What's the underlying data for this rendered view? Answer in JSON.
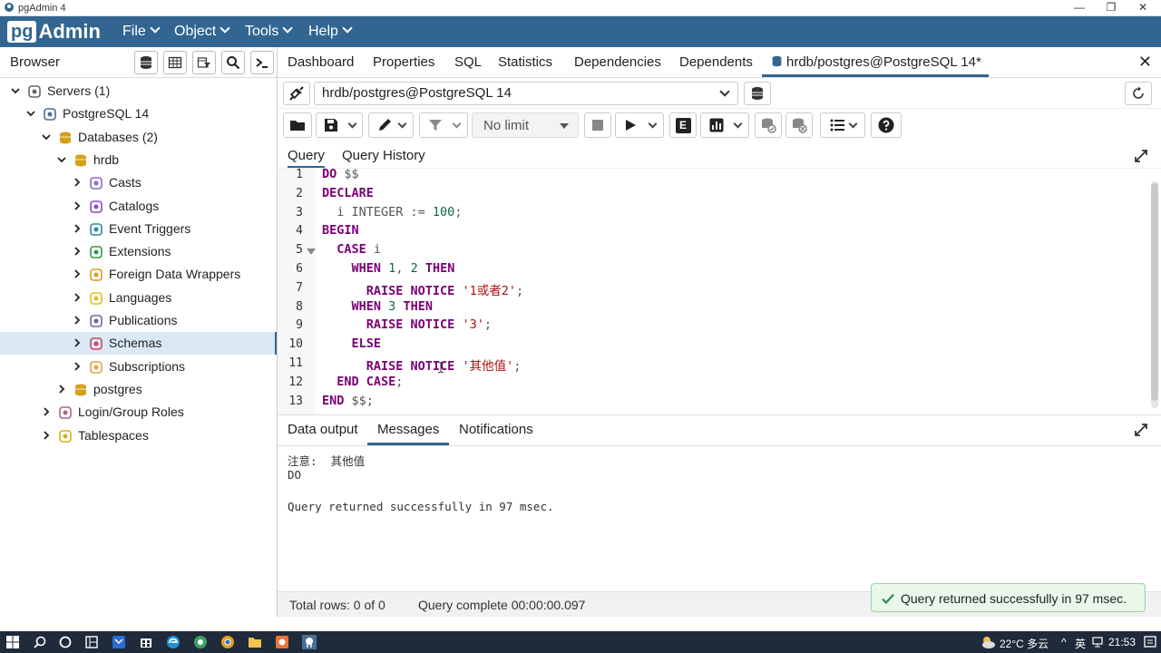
{
  "window": {
    "title": "pgAdmin 4",
    "minimize": "—",
    "maximize": "❐",
    "close": "✕"
  },
  "menubar": {
    "logo_pg": "pg",
    "logo_admin": "Admin",
    "items": [
      "File",
      "Object",
      "Tools",
      "Help"
    ]
  },
  "browser": {
    "label": "Browser",
    "tree": [
      {
        "label": "Servers (1)",
        "icon": "servers-icon"
      },
      {
        "label": "PostgreSQL 14",
        "icon": "elephant-icon"
      },
      {
        "label": "Databases (2)",
        "icon": "databases-icon"
      },
      {
        "label": "hrdb",
        "icon": "database-icon"
      },
      {
        "label": "Casts",
        "icon": "casts-icon"
      },
      {
        "label": "Catalogs",
        "icon": "catalogs-icon"
      },
      {
        "label": "Event Triggers",
        "icon": "event-triggers-icon"
      },
      {
        "label": "Extensions",
        "icon": "extensions-icon"
      },
      {
        "label": "Foreign Data Wrappers",
        "icon": "fdw-icon"
      },
      {
        "label": "Languages",
        "icon": "languages-icon"
      },
      {
        "label": "Publications",
        "icon": "publications-icon"
      },
      {
        "label": "Schemas",
        "icon": "schemas-icon"
      },
      {
        "label": "Subscriptions",
        "icon": "subscriptions-icon"
      },
      {
        "label": "postgres",
        "icon": "database-icon"
      },
      {
        "label": "Login/Group Roles",
        "icon": "roles-icon"
      },
      {
        "label": "Tablespaces",
        "icon": "tablespaces-icon"
      }
    ]
  },
  "tabs": {
    "items": [
      "Dashboard",
      "Properties",
      "SQL",
      "Statistics",
      "Dependencies",
      "Dependents"
    ],
    "active": "hrdb/postgres@PostgreSQL 14*",
    "close": "✕"
  },
  "connection": {
    "value": "hrdb/postgres@PostgreSQL 14"
  },
  "toolbar": {
    "limit": "No limit",
    "explain": "E"
  },
  "query_tabs": [
    "Query",
    "Query History"
  ],
  "editor": {
    "line_numbers": [
      "1",
      "2",
      "3",
      "4",
      "5",
      "6",
      "7",
      "8",
      "9",
      "10",
      "11",
      "12",
      "13"
    ],
    "lines": [
      {
        "kw": "DO",
        "rest": " $$"
      },
      {
        "kw": "DECLARE",
        "rest": ""
      },
      {
        "pre": "  i INTEGER := ",
        "num": "100",
        "post": ";"
      },
      {
        "kw": "BEGIN",
        "rest": ""
      },
      {
        "pre": "  ",
        "kw": "CASE",
        "rest": " i"
      },
      {
        "pre": "    ",
        "kw": "WHEN",
        "n1": "1",
        "sep": ", ",
        "n2": "2",
        "kw2": "THEN"
      },
      {
        "pre": "      ",
        "kw": "RAISE NOTICE",
        "str": "'1或者2'",
        "post": ";"
      },
      {
        "pre": "    ",
        "kw": "WHEN",
        "n1": "3",
        "kw2": "THEN"
      },
      {
        "pre": "      ",
        "kw": "RAISE NOTICE",
        "str": "'3'",
        "post": ";"
      },
      {
        "pre": "    ",
        "kw": "ELSE",
        "rest": ""
      },
      {
        "pre": "      ",
        "kw": "RAISE NOTICE",
        "str": "'其他值'",
        "post": ";"
      },
      {
        "pre": "  ",
        "kw": "END CASE",
        "post": ";"
      },
      {
        "kw": "END",
        "rest": " $$;"
      }
    ]
  },
  "output_tabs": [
    "Data output",
    "Messages",
    "Notifications"
  ],
  "messages": [
    "注意:  其他值",
    "DO",
    "Query returned successfully in 97 msec."
  ],
  "statusbar": {
    "rows": "Total rows: 0 of 0",
    "complete": "Query complete 00:00:00.097"
  },
  "toast": "Query returned successfully in 97 msec.",
  "taskbar": {
    "weather": "22°C 多云",
    "lang": "英",
    "time": "21:53"
  },
  "colors": {
    "brand": "#326690",
    "keyword": "#7a0076",
    "number": "#116644",
    "string": "#aa1111",
    "success": "#2e8b57"
  }
}
